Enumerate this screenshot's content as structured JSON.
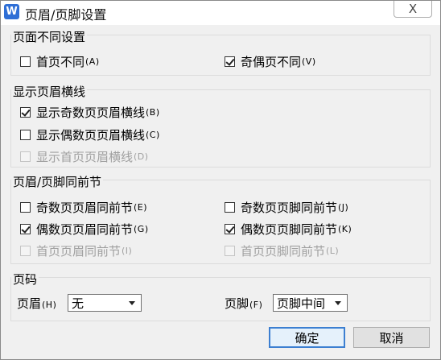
{
  "window": {
    "title": "页眉/页脚设置",
    "app_icon_letter": "W",
    "close_glyph": "X"
  },
  "groups": {
    "diff": {
      "title": "页面不同设置",
      "first_page": {
        "label": "首页不同",
        "hotkey": "(A)",
        "checked": false
      },
      "odd_even": {
        "label": "奇偶页不同",
        "hotkey": "(V)",
        "checked": true
      }
    },
    "lines": {
      "title": "显示页眉横线",
      "odd": {
        "label": "显示奇数页页眉横线",
        "hotkey": "(B)",
        "checked": true
      },
      "even": {
        "label": "显示偶数页页眉横线",
        "hotkey": "(C)",
        "checked": false
      },
      "first": {
        "label": "显示首页页眉横线",
        "hotkey": "(D)",
        "checked": false,
        "disabled": true
      }
    },
    "same": {
      "title": "页眉/页脚同前节",
      "odd_header": {
        "label": "奇数页页眉同前节",
        "hotkey": "(E)",
        "checked": false
      },
      "even_header": {
        "label": "偶数页页眉同前节",
        "hotkey": "(G)",
        "checked": true
      },
      "first_header": {
        "label": "首页页眉同前节",
        "hotkey": "(I)",
        "checked": false,
        "disabled": true
      },
      "odd_footer": {
        "label": "奇数页页脚同前节",
        "hotkey": "(J)",
        "checked": false
      },
      "even_footer": {
        "label": "偶数页页脚同前节",
        "hotkey": "(K)",
        "checked": true
      },
      "first_footer": {
        "label": "首页页脚同前节",
        "hotkey": "(L)",
        "checked": false,
        "disabled": true
      }
    },
    "pagenum": {
      "title": "页码",
      "header_label": "页眉",
      "header_hotkey": "(H)",
      "header_value": "无",
      "footer_label": "页脚",
      "footer_hotkey": "(F)",
      "footer_value": "页脚中间"
    }
  },
  "buttons": {
    "ok": "确定",
    "cancel": "取消"
  },
  "colors": {
    "accent": "#3c7fd1",
    "icon_blue": "#2f6fd6",
    "disabled_text": "#a0a0a0"
  }
}
